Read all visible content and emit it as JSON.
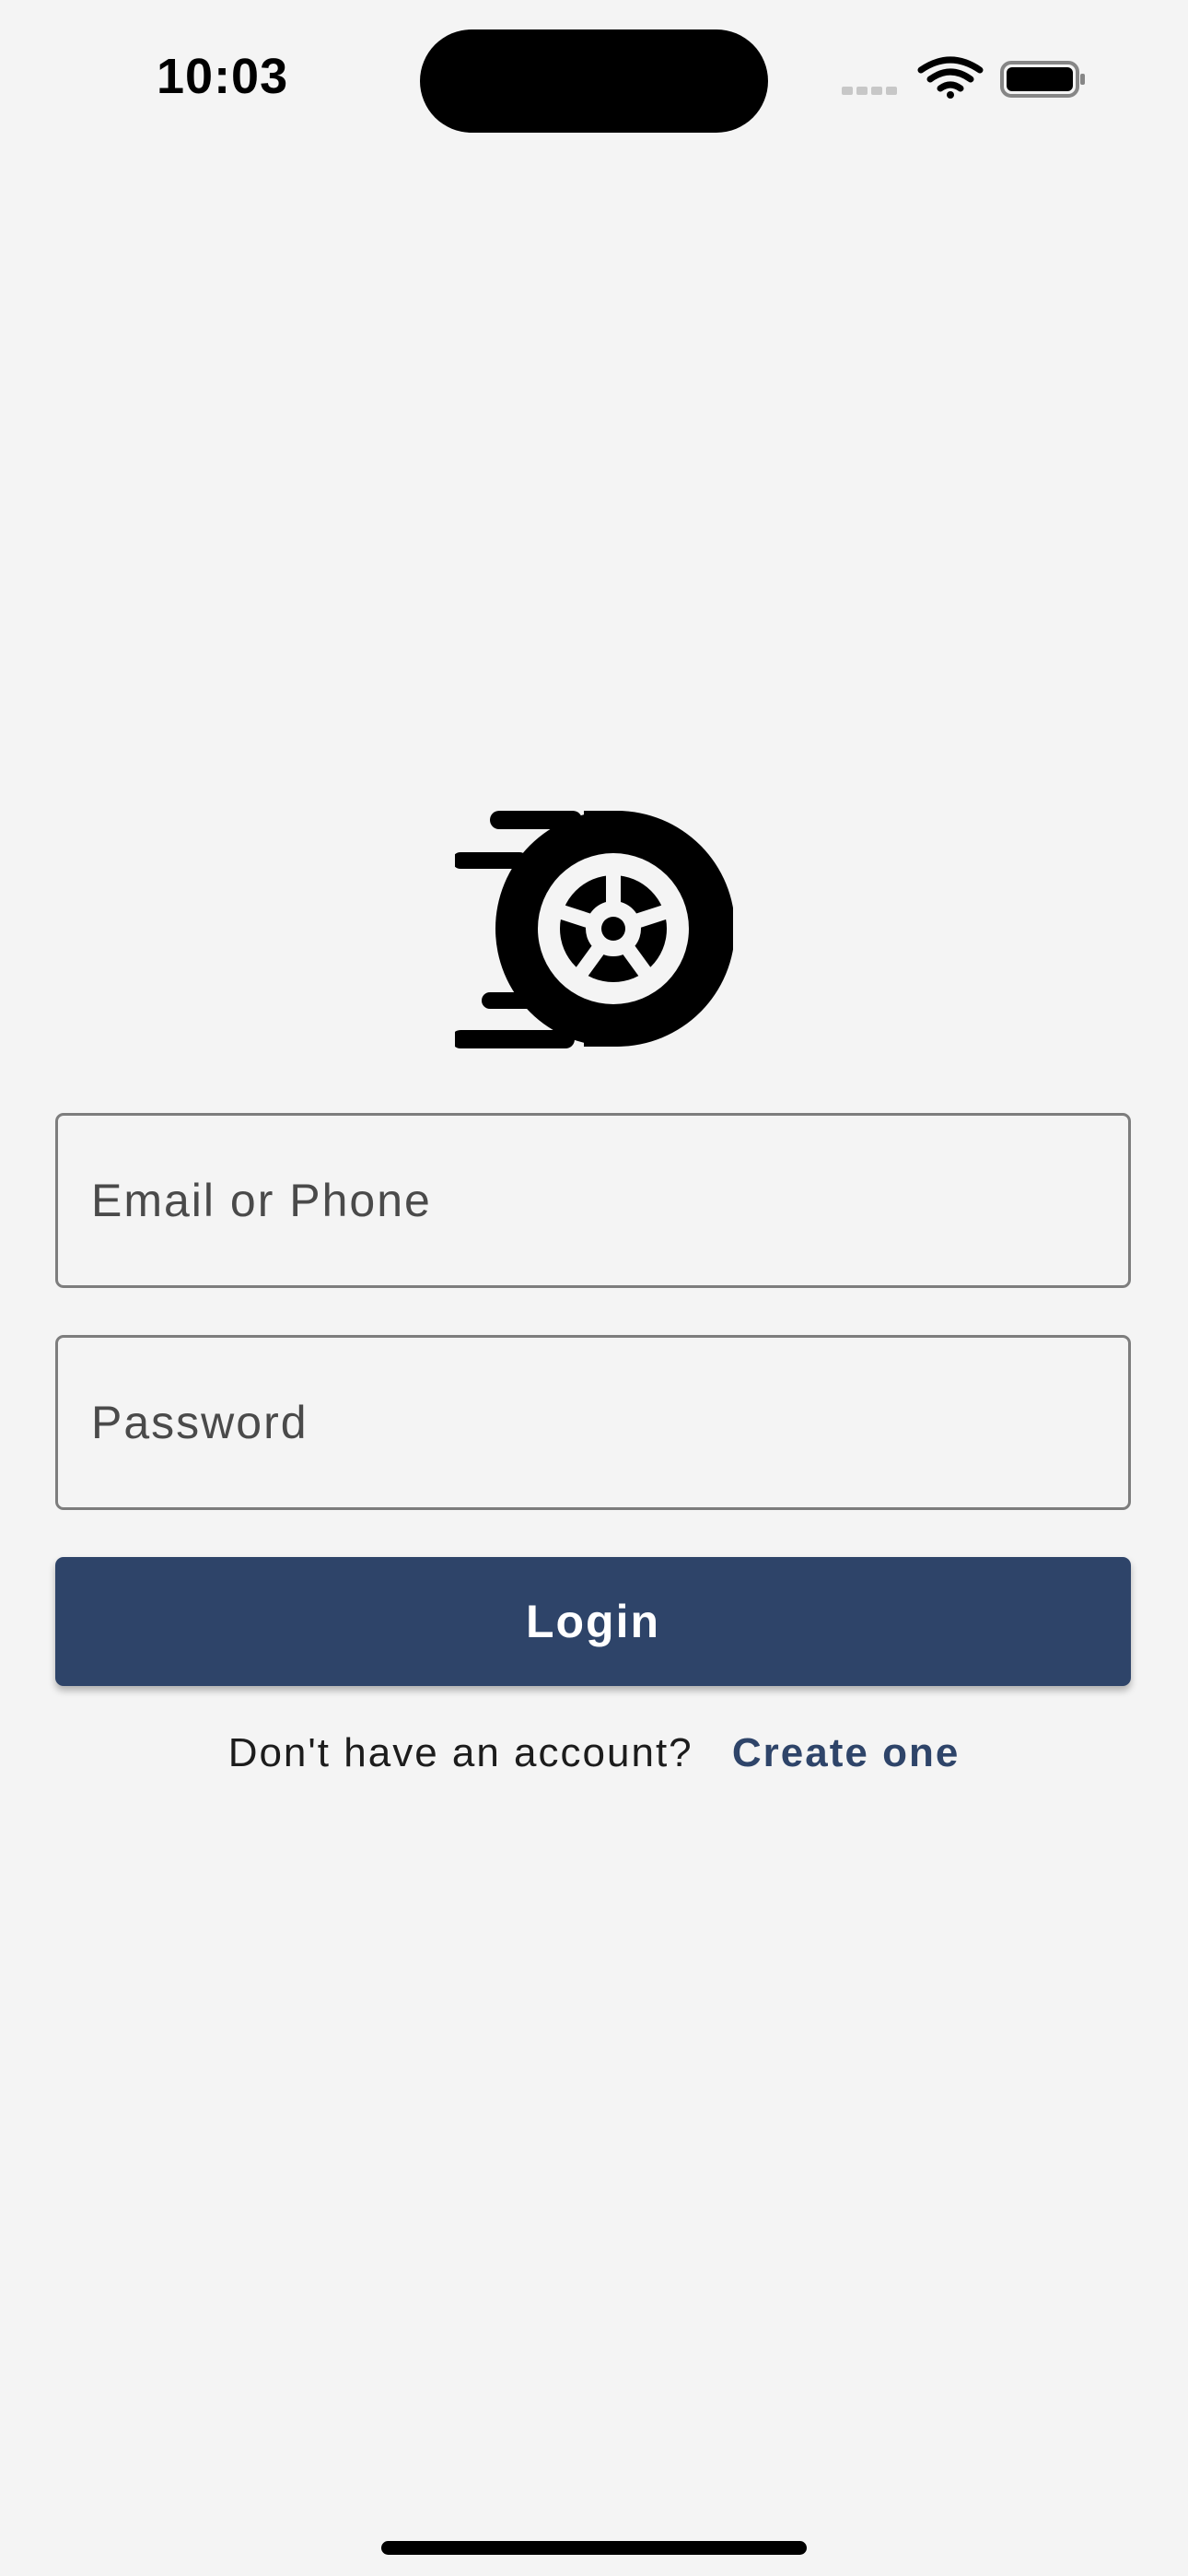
{
  "status_bar": {
    "time": "10:03",
    "icons": [
      "cellular-signal-icon",
      "wifi-icon",
      "battery-icon"
    ]
  },
  "logo": {
    "icon": "speeding-tire-icon"
  },
  "form": {
    "email_placeholder": "Email or Phone",
    "email_value": "",
    "password_placeholder": "Password",
    "password_value": "",
    "login_label": "Login"
  },
  "signup": {
    "prompt": "Don't have an account?",
    "link": "Create one"
  },
  "colors": {
    "background": "#f4f4f4",
    "primary": "#2e4469",
    "border": "#7d7d7d"
  }
}
